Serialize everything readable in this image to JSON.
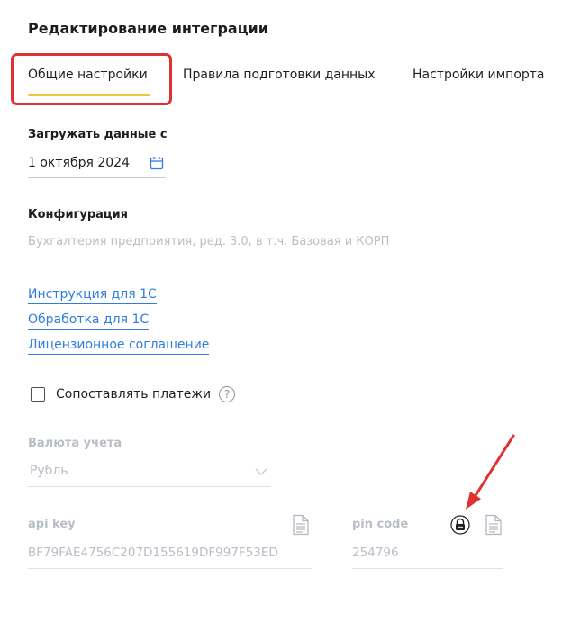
{
  "page": {
    "title": "Редактирование интеграции"
  },
  "tabs": [
    {
      "label": "Общие настройки",
      "active": true
    },
    {
      "label": "Правила подготовки данных",
      "active": false
    },
    {
      "label": "Настройки импорта",
      "active": false
    }
  ],
  "load_from": {
    "label": "Загружать данные с",
    "value": "1 октября 2024",
    "icon": "calendar-icon"
  },
  "configuration": {
    "label": "Конфигурация",
    "placeholder": "Бухгалтерия предприятия, ред. 3.0, в т.ч. Базовая и КОРП"
  },
  "links": [
    {
      "label": "Инструкция для 1С"
    },
    {
      "label": "Обработка для 1С"
    },
    {
      "label": "Лицензионное соглашение"
    }
  ],
  "match_payments": {
    "label": "Сопоставлять платежи",
    "checked": false,
    "help_icon": "question-icon"
  },
  "currency": {
    "label": "Валюта учета",
    "value": "Рубль",
    "icon": "chevron-down-icon"
  },
  "api_key": {
    "label": "api key",
    "value": "BF79FAE4756C207D155619DF997F53ED",
    "icon": "copy-document-icon"
  },
  "pin_code": {
    "label": "pin code",
    "value": "254796",
    "icons": [
      "lock-icon",
      "copy-document-icon"
    ]
  },
  "colors": {
    "accent": "#f2c43a",
    "link": "#2f7de1",
    "highlight": "#e03131",
    "muted": "#b9bec6"
  }
}
